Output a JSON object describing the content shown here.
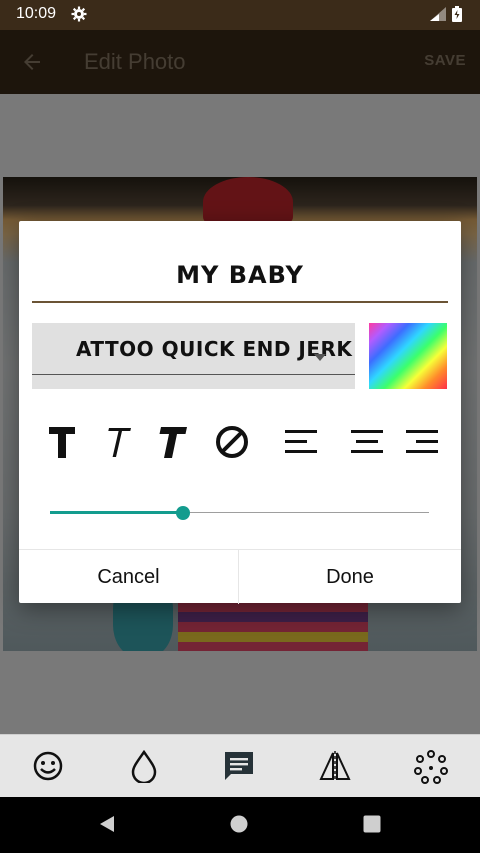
{
  "status_bar": {
    "time": "10:09"
  },
  "toolbar": {
    "title": "Edit Photo",
    "save_label": "SAVE"
  },
  "dialog": {
    "text_value": "MY BABY",
    "font_name": "ATTOO QUICK END JERK",
    "color_swatch_kind": "rainbow gradient",
    "size_level": 0.35,
    "cancel_label": "Cancel",
    "done_label": "Done"
  },
  "icons": {
    "status": [
      "gear-icon",
      "signal-icon",
      "battery-icon"
    ],
    "toolbar": [
      "back-arrow-icon"
    ],
    "style_row": [
      "bold-t-icon",
      "italic-t-icon",
      "bold-italic-t-icon",
      "no-style-icon",
      "align-left-icon",
      "align-center-icon",
      "align-right-icon"
    ],
    "bottom_tools": [
      "emoji-icon",
      "drop-icon",
      "text-bubble-icon",
      "mirror-icon",
      "filters-icon"
    ],
    "nav": [
      "back-triangle-icon",
      "home-circle-icon",
      "recents-square-icon"
    ]
  }
}
